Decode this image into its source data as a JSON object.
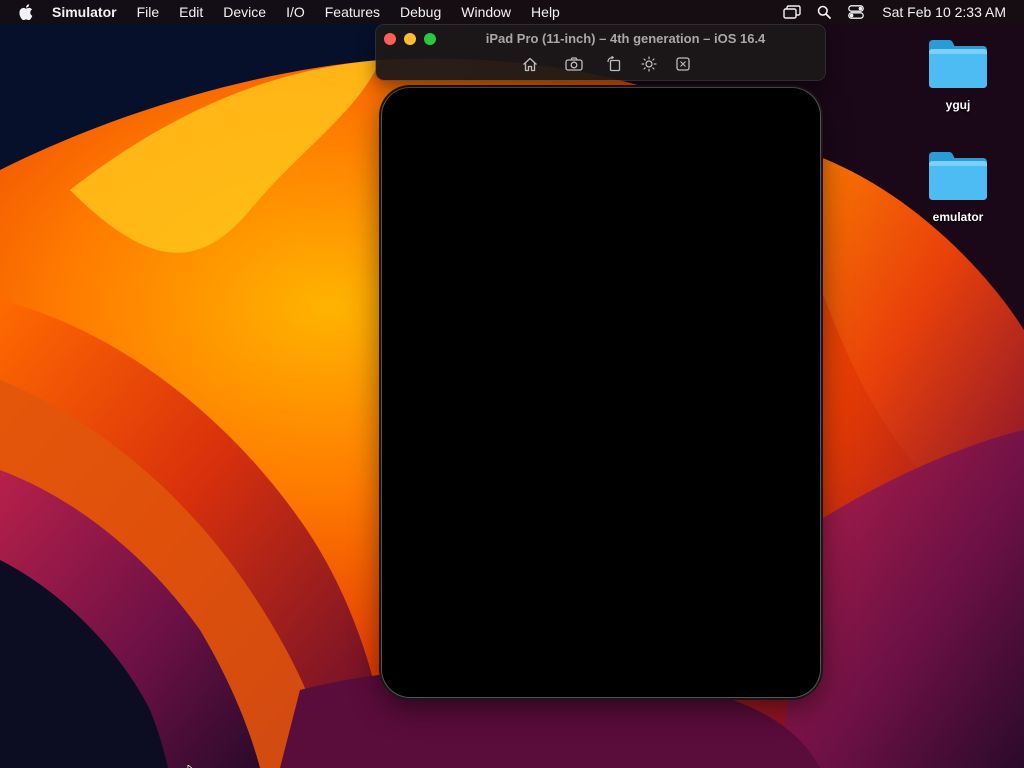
{
  "menubar": {
    "apple_icon": "apple-logo",
    "app_name": "Simulator",
    "menus": [
      "File",
      "Edit",
      "Device",
      "I/O",
      "Features",
      "Debug",
      "Window",
      "Help"
    ],
    "status_icons": [
      "screen-mirroring-icon",
      "search-icon",
      "control-center-icon"
    ],
    "clock": "Sat Feb 10  2:33 AM"
  },
  "simulator": {
    "title": "iPad Pro (11-inch) – 4th generation – iOS 16.4",
    "toolbar_icons": [
      "home-icon",
      "screenshot-icon",
      "rotate-icon",
      "appearance-icon",
      "keyboard-icon"
    ]
  },
  "desktop": {
    "items": [
      {
        "label": "yguj",
        "icon": "folder-icon"
      },
      {
        "label": "emulator",
        "icon": "folder-icon"
      }
    ]
  },
  "colors": {
    "traffic_close": "#ff5f57",
    "traffic_minimize": "#febc2e",
    "traffic_zoom": "#28c840",
    "folder_blue": "#3fb6f0"
  }
}
